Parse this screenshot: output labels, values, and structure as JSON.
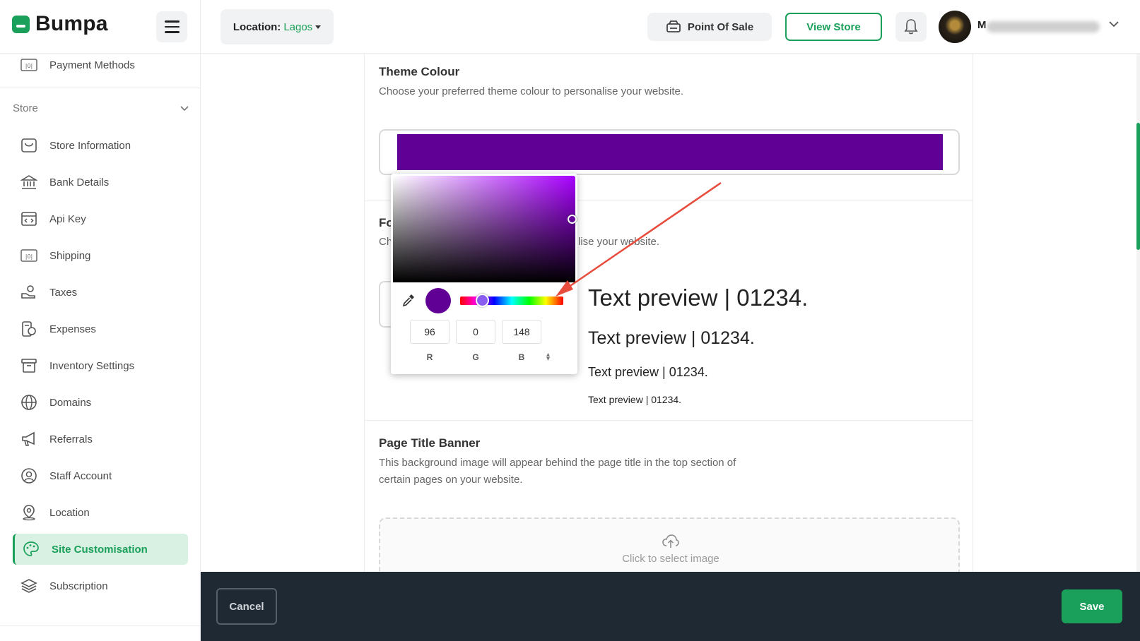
{
  "brand": {
    "name": "Bumpa",
    "accent": "#1aa05a"
  },
  "header": {
    "location_label": "Location:",
    "location_value": "Lagos",
    "pos_label": "Point Of Sale",
    "view_store_label": "View Store",
    "user_initial": "M"
  },
  "sidebar": {
    "top_item": "Payment Methods",
    "group_label": "Store",
    "items": [
      {
        "label": "Store Information",
        "icon": "store-icon"
      },
      {
        "label": "Bank Details",
        "icon": "bank-icon"
      },
      {
        "label": "Api Key",
        "icon": "code-icon"
      },
      {
        "label": "Shipping",
        "icon": "shipping-icon"
      },
      {
        "label": "Taxes",
        "icon": "taxes-icon"
      },
      {
        "label": "Expenses",
        "icon": "expenses-icon"
      },
      {
        "label": "Inventory Settings",
        "icon": "inventory-icon"
      },
      {
        "label": "Domains",
        "icon": "globe-icon"
      },
      {
        "label": "Referrals",
        "icon": "megaphone-icon"
      },
      {
        "label": "Staff Account",
        "icon": "user-circle-icon"
      },
      {
        "label": "Location",
        "icon": "location-pin-icon"
      },
      {
        "label": "Site Customisation",
        "icon": "palette-icon",
        "active": true
      },
      {
        "label": "Subscription",
        "icon": "layers-icon"
      }
    ]
  },
  "theme": {
    "title": "Theme Colour",
    "description": "Choose your preferred theme colour to personalise your website.",
    "color_hex": "#600094"
  },
  "font": {
    "title_fragment": "Fo",
    "desc_fragment": "Ch",
    "desc_tail": "lise your website.",
    "previews": [
      "Text preview | 01234.",
      "Text preview | 01234.",
      "Text preview | 01234.",
      "Text preview | 01234."
    ]
  },
  "color_picker": {
    "r": "96",
    "g": "0",
    "b": "148",
    "r_label": "R",
    "g_label": "G",
    "b_label": "B"
  },
  "banner": {
    "title": "Page Title Banner",
    "description_line1": "This background image will appear behind the page title in the top section of",
    "description_line2": "certain pages on your website.",
    "upload_text": "Click to select image"
  },
  "footer": {
    "cancel_label": "Cancel",
    "save_label": "Save"
  }
}
